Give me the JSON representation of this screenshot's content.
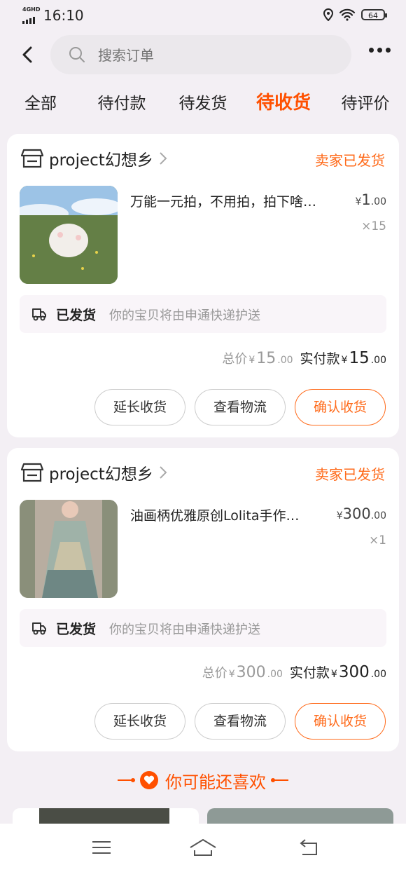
{
  "status_bar": {
    "network": "4GHD",
    "time": "16:10",
    "battery": "64"
  },
  "search": {
    "placeholder": "搜索订单"
  },
  "tabs": [
    {
      "label": "全部"
    },
    {
      "label": "待付款"
    },
    {
      "label": "待发货"
    },
    {
      "label": "待收货",
      "active": true
    },
    {
      "label": "待评价"
    }
  ],
  "orders": [
    {
      "shop": "project幻想乡",
      "status": "卖家已发货",
      "title": "万能一元拍，不用拍，拍下啥…",
      "price_symbol": "¥",
      "price_int": "1",
      "price_dec": ".00",
      "qty": "×15",
      "ship_label": "已发货",
      "ship_desc": "你的宝贝将由申通快递护送",
      "total_label": "总价",
      "total_int": "15",
      "total_dec": ".00",
      "paid_label": "实付款",
      "paid_int": "15",
      "paid_dec": ".00",
      "buttons": [
        "延长收货",
        "查看物流",
        "确认收货"
      ]
    },
    {
      "shop": "project幻想乡",
      "status": "卖家已发货",
      "title": "油画柄优雅原创Lolita手作…",
      "price_symbol": "¥",
      "price_int": "300",
      "price_dec": ".00",
      "qty": "×1",
      "ship_label": "已发货",
      "ship_desc": "你的宝贝将由申通快递护送",
      "total_label": "总价",
      "total_int": "300",
      "total_dec": ".00",
      "paid_label": "实付款",
      "paid_int": "300",
      "paid_dec": ".00",
      "buttons": [
        "延长收货",
        "查看物流",
        "确认收货"
      ]
    }
  ],
  "recommend": {
    "title": "你可能还喜欢"
  },
  "colors": {
    "accent": "#ff5000",
    "status": "#ff6a1a",
    "background": "#f3eff4"
  }
}
